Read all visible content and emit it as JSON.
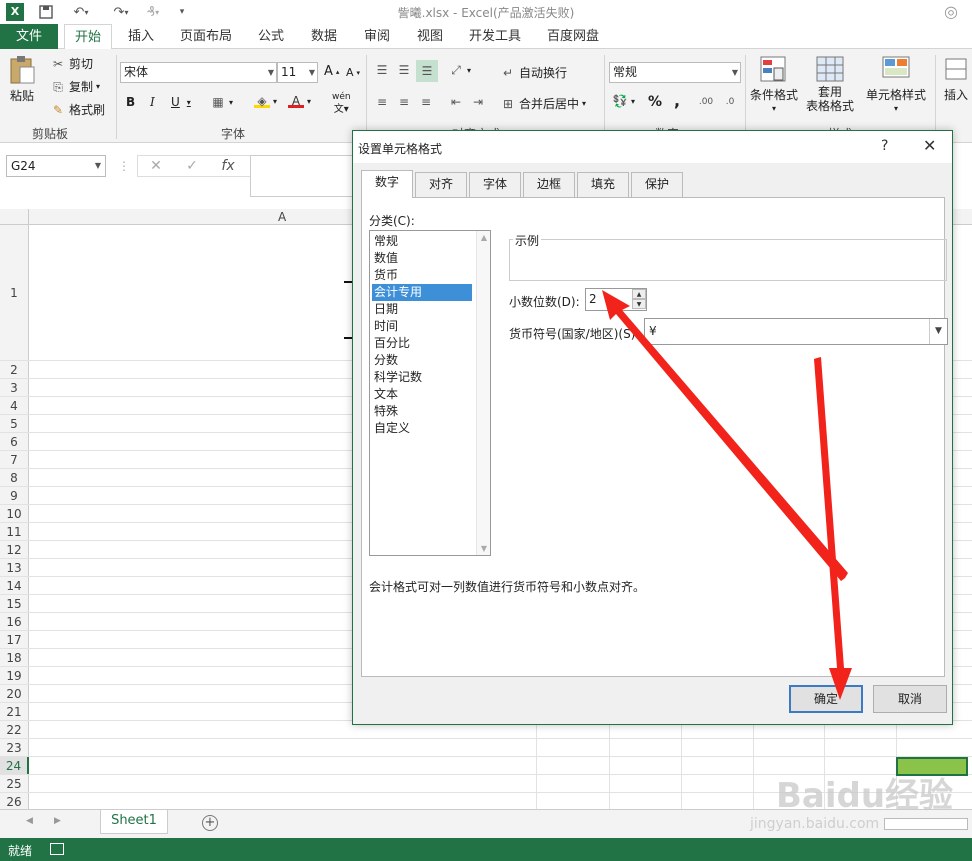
{
  "window": {
    "title": "訾曦.xlsx - Excel(产品激活失败)",
    "app_logo": "X"
  },
  "quick_access": {
    "save_icon": "save-icon",
    "undo_icon": "undo-icon",
    "redo_icon": "redo-icon"
  },
  "tabs": {
    "file": "文件",
    "items": [
      "开始",
      "插入",
      "页面布局",
      "公式",
      "数据",
      "审阅",
      "视图",
      "开发工具",
      "百度网盘"
    ],
    "active": "开始"
  },
  "ribbon": {
    "clipboard": {
      "paste": "粘贴",
      "cut": "剪切",
      "copy": "复制",
      "format_painter": "格式刷",
      "label": "剪贴板"
    },
    "font": {
      "name": "宋体",
      "size": "11",
      "bold": "B",
      "italic": "I",
      "underline": "U",
      "label": "字体",
      "wen": "wén"
    },
    "alignment": {
      "wrap": "自动换行",
      "merge": "合并后居中",
      "label": "对齐方式"
    },
    "number": {
      "format": "常规",
      "percent": "%",
      "comma": ",",
      "label": "数字"
    },
    "styles": {
      "conditional": "条件格式",
      "table": "套用",
      "table2": "表格格式",
      "cell": "单元格样式",
      "label": "样式"
    },
    "cells": {
      "insert": "插入"
    }
  },
  "formula_bar": {
    "name_box": "G24",
    "cancel": "✕",
    "enter": "✓",
    "fx": "fx"
  },
  "grid": {
    "column_a": "A",
    "rows": [
      "1",
      "2",
      "3",
      "4",
      "5",
      "6",
      "7",
      "8",
      "9",
      "10",
      "11",
      "12",
      "13",
      "14",
      "15",
      "16",
      "17",
      "18",
      "19",
      "20",
      "21",
      "22",
      "23",
      "24",
      "25",
      "26"
    ],
    "selected_row": "24"
  },
  "sheets": {
    "tab": "Sheet1",
    "add": "+"
  },
  "status": {
    "text": "就绪"
  },
  "dialog": {
    "title": "设置单元格格式",
    "help": "?",
    "close": "✕",
    "tabs": [
      "数字",
      "对齐",
      "字体",
      "边框",
      "填充",
      "保护"
    ],
    "active_tab": "数字",
    "category_label": "分类(C):",
    "categories": [
      "常规",
      "数值",
      "货币",
      "会计专用",
      "日期",
      "时间",
      "百分比",
      "分数",
      "科学记数",
      "文本",
      "特殊",
      "自定义"
    ],
    "selected_category": "会计专用",
    "sample_label": "示例",
    "decimals_label": "小数位数(D):",
    "decimals_value": "2",
    "currency_label": "货币符号(国家/地区)(S):",
    "currency_value": "¥",
    "description": "会计格式可对一列数值进行货币符号和小数点对齐。",
    "ok": "确定",
    "cancel": "取消"
  },
  "watermark": {
    "brand": "Baidu经验",
    "url": "jingyan.baidu.com"
  },
  "colors": {
    "excel_green": "#217346",
    "annotation_red": "#f2231a",
    "selected_cell": "#8bc34a",
    "selection_blue": "#3d8fd8"
  }
}
